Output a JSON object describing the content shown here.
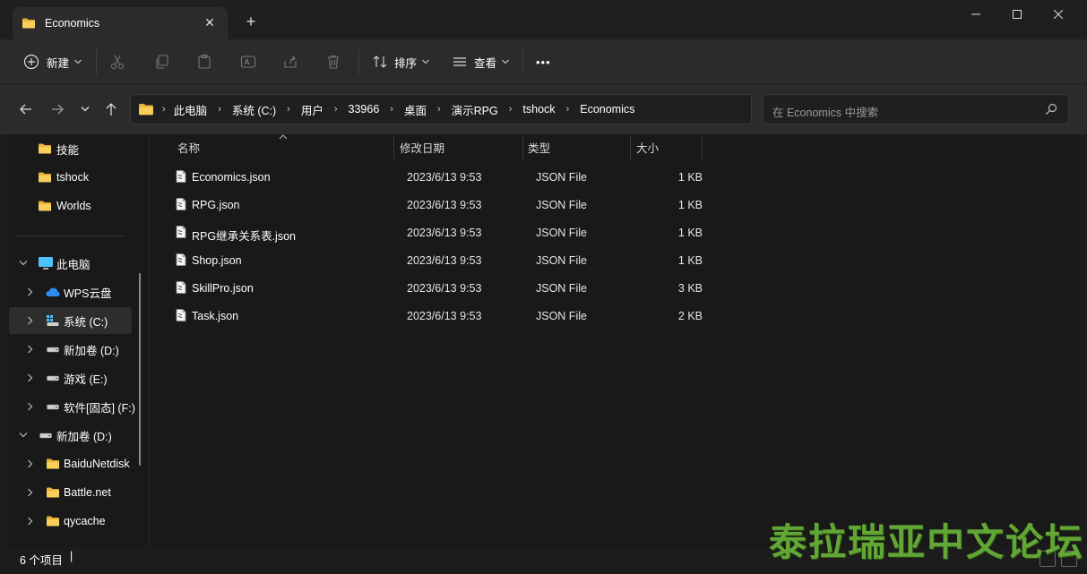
{
  "window": {
    "tab_title": "Economics",
    "tab_close": "✕",
    "new_tab": "+",
    "minimize": "─",
    "maximize": "☐",
    "close": "✕"
  },
  "toolbar": {
    "new_label": "新建",
    "sort_label": "排序",
    "view_label": "查看",
    "more": "•••"
  },
  "address": {
    "crumbs": [
      "此电脑",
      "系统 (C:)",
      "用户",
      "33966",
      "桌面",
      "演示RPG",
      "tshock",
      "Economics"
    ],
    "separator": "›",
    "search_placeholder": "在 Economics 中搜索"
  },
  "sidebar": {
    "items": [
      {
        "label": "技能",
        "icon": "folder-icon"
      },
      {
        "label": "tshock",
        "icon": "folder-icon"
      },
      {
        "label": "Worlds",
        "icon": "folder-icon"
      },
      {
        "label": "此电脑",
        "icon": "computer-icon"
      },
      {
        "label": "WPS云盘",
        "icon": "cloud-icon"
      },
      {
        "label": "系统 (C:)",
        "icon": "windows-drive-icon"
      },
      {
        "label": "新加卷 (D:)",
        "icon": "drive-icon"
      },
      {
        "label": "游戏 (E:)",
        "icon": "drive-icon"
      },
      {
        "label": "软件[固态] (F:)",
        "icon": "drive-icon"
      },
      {
        "label": "新加卷 (D:)",
        "icon": "drive-icon"
      },
      {
        "label": "BaiduNetdisk",
        "icon": "folder-icon"
      },
      {
        "label": "Battle.net",
        "icon": "folder-icon"
      },
      {
        "label": "qycache",
        "icon": "folder-icon"
      }
    ]
  },
  "columns": {
    "name": "名称",
    "date": "修改日期",
    "type": "类型",
    "size": "大小"
  },
  "files": [
    {
      "name": "Economics.json",
      "date": "2023/6/13 9:53",
      "type": "JSON File",
      "size": "1 KB"
    },
    {
      "name": "RPG.json",
      "date": "2023/6/13 9:53",
      "type": "JSON File",
      "size": "1 KB"
    },
    {
      "name": "RPG继承关系表.json",
      "date": "2023/6/13 9:53",
      "type": "JSON File",
      "size": "1 KB"
    },
    {
      "name": "Shop.json",
      "date": "2023/6/13 9:53",
      "type": "JSON File",
      "size": "1 KB"
    },
    {
      "name": "SkillPro.json",
      "date": "2023/6/13 9:53",
      "type": "JSON File",
      "size": "3 KB"
    },
    {
      "name": "Task.json",
      "date": "2023/6/13 9:53",
      "type": "JSON File",
      "size": "2 KB"
    }
  ],
  "status": {
    "item_count": "6 个项目",
    "caret": "|"
  },
  "watermark": "泰拉瑞亚中文论坛",
  "colors": {
    "folder": "#f4c542",
    "accent": "#4cc2ff"
  }
}
